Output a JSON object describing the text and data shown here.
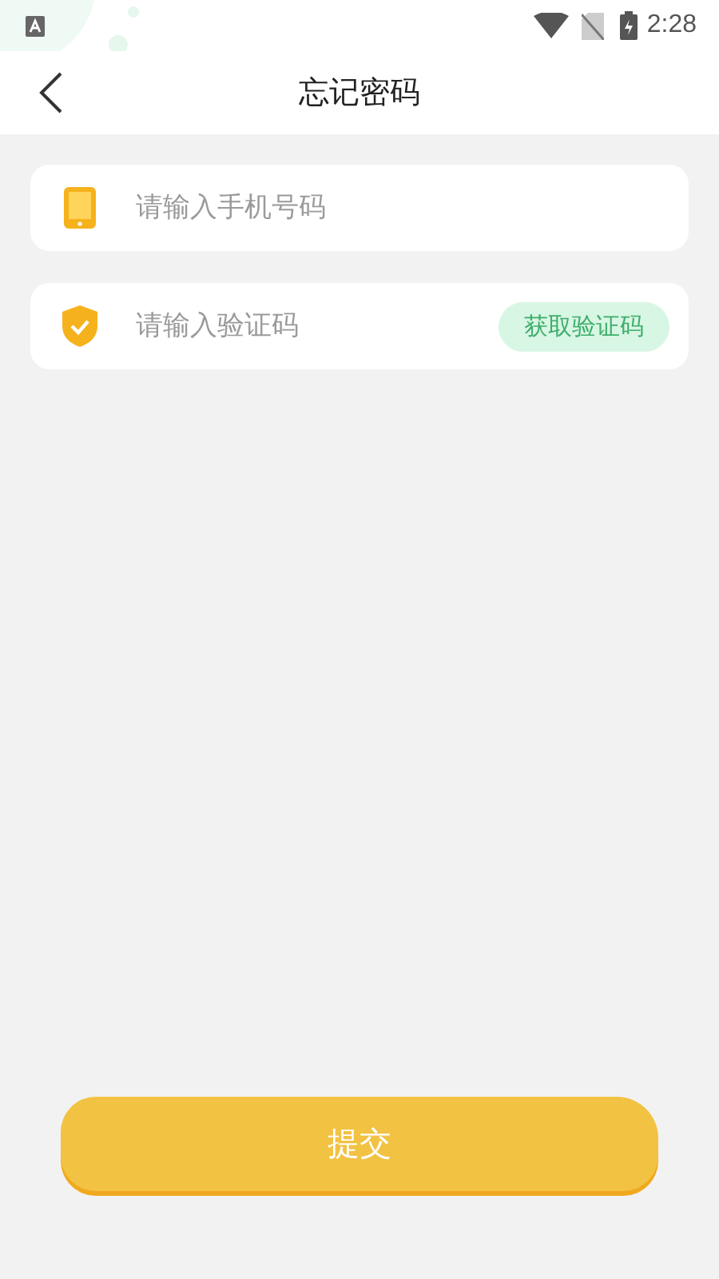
{
  "status_bar": {
    "time": "2:28"
  },
  "header": {
    "title": "忘记密码"
  },
  "fields": [
    {
      "kind": "phone",
      "placeholder": "请输入手机号码"
    },
    {
      "kind": "code",
      "placeholder": "请输入验证码",
      "action": "获取验证码"
    }
  ],
  "submit": {
    "label": "提交"
  }
}
